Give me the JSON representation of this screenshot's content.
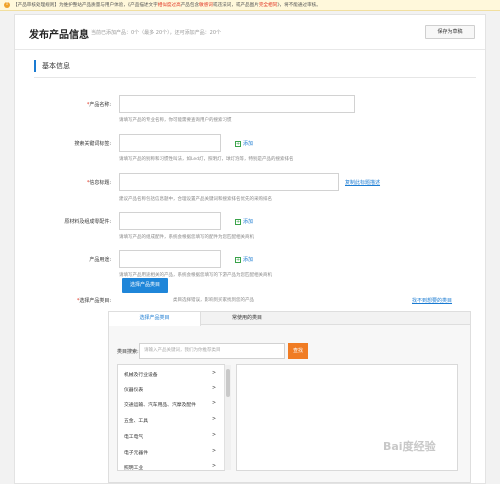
{
  "notice": {
    "icon": "warning-icon",
    "parts": [
      {
        "text": "【产品审核处理规则】为维护整站产品质量与用户体验，《产品描述文字",
        "red": false
      },
      {
        "text": "相似度过高",
        "red": true
      },
      {
        "text": "产品包含",
        "red": false
      },
      {
        "text": "敏感词",
        "red": true
      },
      {
        "text": "或违法词，或产品图片",
        "red": false
      },
      {
        "text": "完全相同",
        "red": true
      },
      {
        "text": "》，将不能通过审核。",
        "red": false
      }
    ]
  },
  "header": {
    "title": "发布产品信息",
    "stats": "当前已添加产品：0个（最多 20个），还可添加产品：20个",
    "draft_button": "保存为草稿"
  },
  "section": {
    "title": "基本信息"
  },
  "form": {
    "product_name": {
      "label": "产品名称:",
      "hint": "请填写产品的专业名称，你可能需要查询用户的搜索习惯"
    },
    "search_keywords": {
      "label": "搜索关键词标签:",
      "add": "添加",
      "hint": "请填写产品的别称和习惯性叫法，如Led灯，照明灯，球灯泡等，特别是产品的搜索排名"
    },
    "info_title": {
      "label": "信息标题:",
      "link": "复制此标题描述",
      "hint": "建议产品名称包括信息题中，合理设置产品关键词和搜索排名优先的采购排名"
    },
    "materials": {
      "label": "原材料及组成零配件:",
      "add": "添加",
      "hint": "请填写产品的组成配件，系统会根据您填写的配件为您匹配相关商机"
    },
    "usage": {
      "label": "产品用途:",
      "add": "添加",
      "hint": "请填写产品用途相关的产品，系统会根据您填写的下游产品为您匹配相关商机"
    },
    "category": {
      "label": "选择产品类目:",
      "button": "选择产品类目",
      "hint": "类目选择错误，影响到买家找到您的产品",
      "link": "找不到想要的类目"
    }
  },
  "category_box": {
    "tabs": [
      "选择产品类目",
      "常使用的类目"
    ],
    "search_label": "类目搜索:",
    "search_placeholder": "请输入产品关键词，我们为你推荐类目",
    "search_button": "查找",
    "items": [
      "机械及行业设备",
      "仪器仪表",
      "交通运输、汽车用品、汽摩及配件",
      "五金、工具",
      "电工电气",
      "电子元器件",
      "照明工业"
    ]
  },
  "watermark": "Bai度经验"
}
